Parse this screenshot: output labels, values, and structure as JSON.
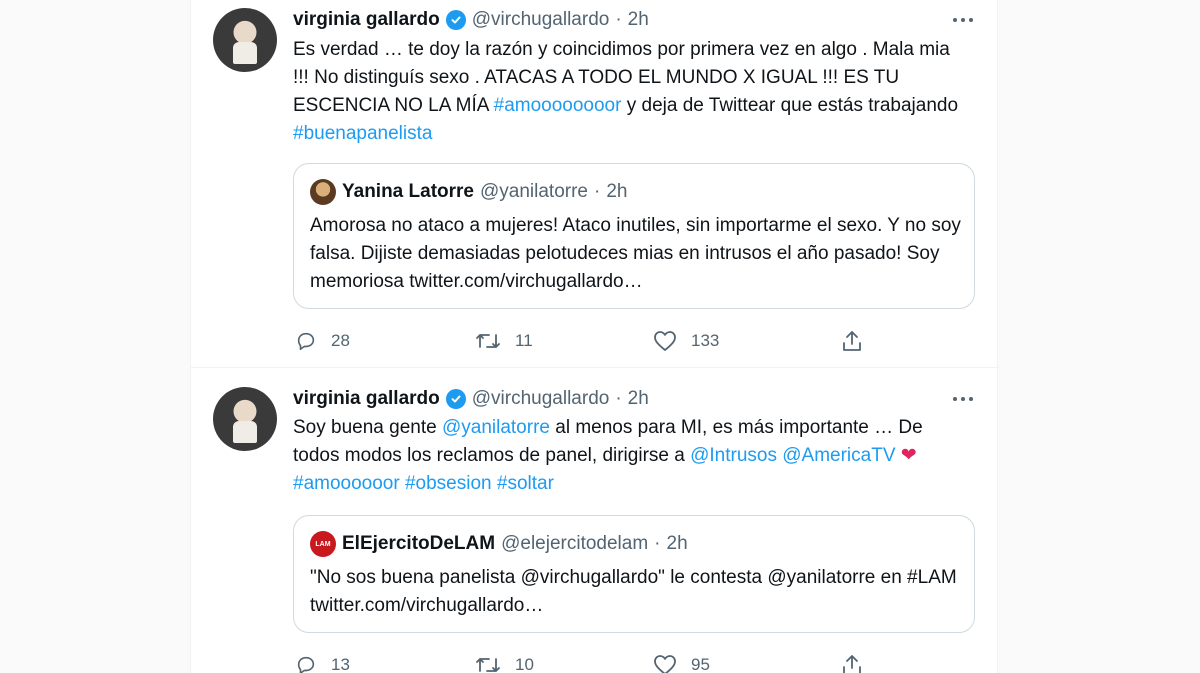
{
  "tweets": [
    {
      "author": {
        "name": "virginia gallardo",
        "handle": "@virchugallardo",
        "separator": "·",
        "time": "2h"
      },
      "text": {
        "part1": "Es verdad … te doy la razón y coincidimos por primera vez en algo . Mala mia !!! No distinguís sexo . ATACAS A TODO EL MUNDO X IGUAL !!! ES TU ESCENCIA NO LA MÍA ",
        "hashtag1": "#amoooooooor",
        "part2": " y deja de Twittear que estás trabajando ",
        "hashtag2": "#buenapanelista"
      },
      "quote": {
        "name": "Yanina Latorre",
        "handle": "@yanilatorre",
        "separator": "·",
        "time": "2h",
        "text": "Amorosa no ataco a mujeres! Ataco inutiles, sin importarme el sexo. Y no soy falsa. Dijiste demasiadas pelotudeces mias en intrusos el año pasado! Soy memoriosa twitter.com/virchugallardo…"
      },
      "stats": {
        "replies": "28",
        "retweets": "11",
        "likes": "133"
      }
    },
    {
      "author": {
        "name": "virginia gallardo",
        "handle": "@virchugallardo",
        "separator": "·",
        "time": "2h"
      },
      "text": {
        "part1": "Soy buena gente ",
        "mention1": "@yanilatorre",
        "part2": "  al menos para MI, es más importante … De todos modos los reclamos de panel, dirigirse a ",
        "mention2": "@Intrusos",
        "space1": " ",
        "mention3": "@AmericaTV",
        "emoji": " ❤",
        "hashtag1": "#amoooooor",
        "space2": " ",
        "hashtag2": "#obsesion",
        "space3": " ",
        "hashtag3": "#soltar"
      },
      "quote": {
        "avatar_text": "LAM",
        "name": "ElEjercitoDeLAM",
        "handle": "@elejercitodelam",
        "separator": "·",
        "time": "2h",
        "text": "\"No sos buena panelista @virchugallardo\" le contesta @yanilatorre en #LAM twitter.com/virchugallardo…"
      },
      "stats": {
        "replies": "13",
        "retweets": "10",
        "likes": "95"
      }
    }
  ],
  "icons": {
    "verified": "verified-badge-icon",
    "more": "more-options-icon",
    "reply": "reply-icon",
    "retweet": "retweet-icon",
    "like": "heart-icon",
    "share": "share-icon"
  },
  "colors": {
    "link": "#1d9bf0",
    "text": "#0f1419",
    "secondary": "#536471",
    "border": "#cfd9de",
    "heart": "#e0245e"
  }
}
